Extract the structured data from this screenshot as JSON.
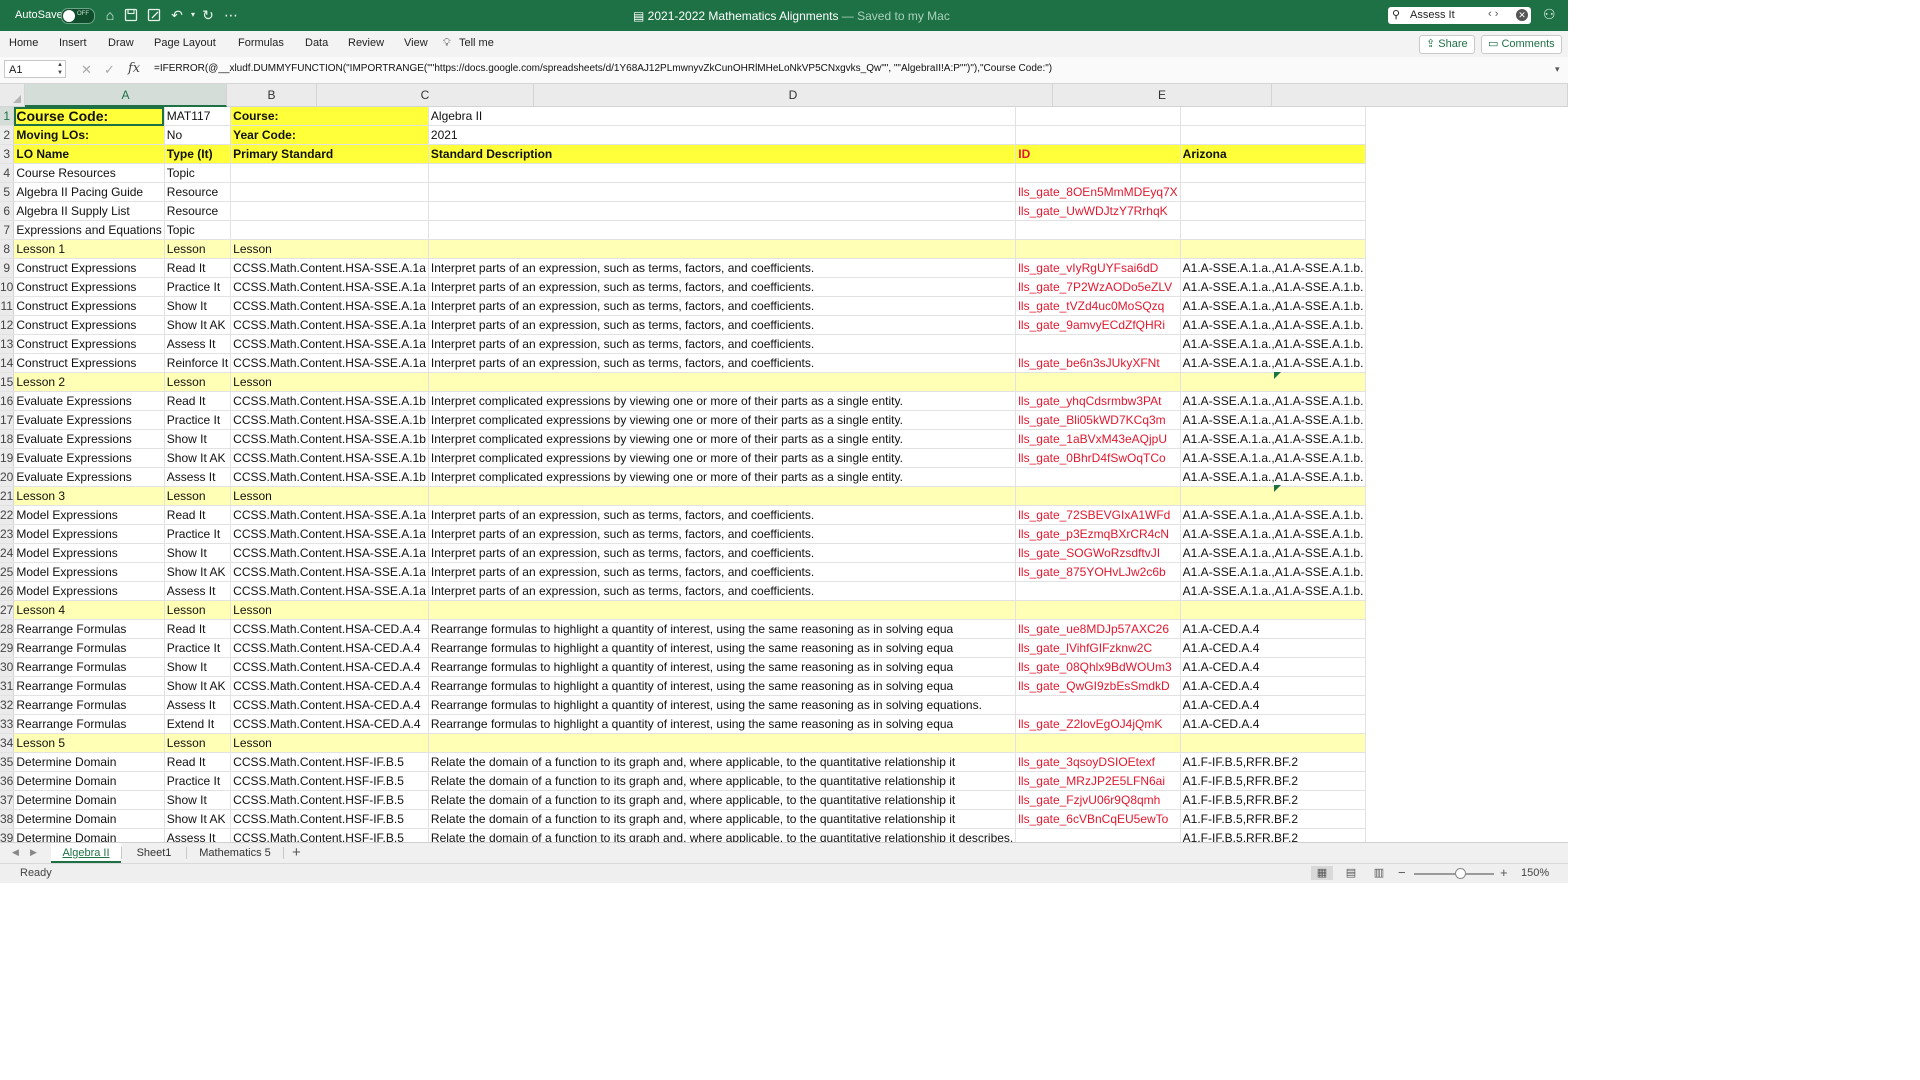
{
  "titlebar": {
    "autosave_label": "AutoSave",
    "autosave_state": "OFF",
    "doc_title": "2021-2022 Mathematics Alignments",
    "saved_status": "— Saved to my Mac",
    "search_value": "Assess It"
  },
  "ribbon": {
    "tabs": [
      "Home",
      "Insert",
      "Draw",
      "Page Layout",
      "Formulas",
      "Data",
      "Review",
      "View"
    ],
    "tell_me": "Tell me",
    "share": "Share",
    "comments": "Comments"
  },
  "formula_bar": {
    "name_box": "A1",
    "formula": "=IFERROR(@__xludf.DUMMYFUNCTION(\"IMPORTRANGE(\"\"https://docs.google.com/spreadsheets/d/1Y68AJ12PLmwnyvZkCunOHRlMHeLoNkVP5CNxgvks_Qw\"\", \"\"AlgebraII!A:P\"\")\"),\"Course Code:\")"
  },
  "columns": [
    "A",
    "B",
    "C",
    "D",
    "E",
    ""
  ],
  "rows": [
    {
      "n": "1",
      "c": [
        "Course Code:",
        "MAT117",
        "Course:",
        "Algebra II",
        "",
        ""
      ]
    },
    {
      "n": "2",
      "c": [
        "Moving LOs:",
        "No",
        "Year Code:",
        "2021",
        "",
        ""
      ]
    },
    {
      "n": "3",
      "c": [
        "LO Name",
        "Type (It)",
        "Primary Standard",
        "Standard Description",
        "ID",
        "Arizona"
      ]
    },
    {
      "n": "4",
      "c": [
        "Course Resources",
        "Topic",
        "",
        "",
        "",
        ""
      ]
    },
    {
      "n": "5",
      "c": [
        "Algebra II Pacing Guide",
        "Resource",
        "",
        "",
        "lls_gate_8OEn5MmMDEyq7X",
        ""
      ]
    },
    {
      "n": "6",
      "c": [
        "Algebra II Supply List",
        "Resource",
        "",
        "",
        "lls_gate_UwWDJtzY7RrhqK",
        ""
      ]
    },
    {
      "n": "7",
      "c": [
        "Expressions and Equations",
        "Topic",
        "",
        "",
        "",
        ""
      ]
    },
    {
      "n": "8",
      "c": [
        "Lesson 1",
        "Lesson",
        "Lesson",
        "",
        "",
        ""
      ]
    },
    {
      "n": "9",
      "c": [
        "Construct Expressions",
        "Read It",
        "CCSS.Math.Content.HSA-SSE.A.1a",
        "Interpret parts of an expression, such as terms, factors, and coefficients.",
        "lls_gate_vIyRgUYFsai6dD",
        "A1.A-SSE.A.1.a.,A1.A-SSE.A.1.b."
      ]
    },
    {
      "n": "10",
      "c": [
        "Construct Expressions",
        "Practice It",
        "CCSS.Math.Content.HSA-SSE.A.1a",
        "Interpret parts of an expression, such as terms, factors, and coefficients.",
        "lls_gate_7P2WzAODo5eZLV",
        "A1.A-SSE.A.1.a.,A1.A-SSE.A.1.b."
      ]
    },
    {
      "n": "11",
      "c": [
        "Construct Expressions",
        "Show It",
        "CCSS.Math.Content.HSA-SSE.A.1a",
        "Interpret parts of an expression, such as terms, factors, and coefficients.",
        "lls_gate_tVZd4uc0MoSQzq",
        "A1.A-SSE.A.1.a.,A1.A-SSE.A.1.b."
      ]
    },
    {
      "n": "12",
      "c": [
        "Construct Expressions",
        "Show It AK",
        "CCSS.Math.Content.HSA-SSE.A.1a",
        "Interpret parts of an expression, such as terms, factors, and coefficients.",
        "lls_gate_9amvyECdZfQHRi",
        "A1.A-SSE.A.1.a.,A1.A-SSE.A.1.b."
      ]
    },
    {
      "n": "13",
      "c": [
        "Construct Expressions",
        "Assess It",
        "CCSS.Math.Content.HSA-SSE.A.1a",
        "Interpret parts of an expression, such as terms, factors, and coefficients.",
        "",
        "A1.A-SSE.A.1.a.,A1.A-SSE.A.1.b."
      ]
    },
    {
      "n": "14",
      "c": [
        "Construct Expressions",
        "Reinforce It",
        "CCSS.Math.Content.HSA-SSE.A.1a",
        "Interpret parts of an expression, such as terms, factors, and coefficients.",
        "lls_gate_be6n3sJUkyXFNt",
        "A1.A-SSE.A.1.a.,A1.A-SSE.A.1.b."
      ]
    },
    {
      "n": "15",
      "c": [
        "Lesson 2",
        "Lesson",
        "Lesson",
        "",
        "",
        ""
      ]
    },
    {
      "n": "16",
      "c": [
        "Evaluate Expressions",
        "Read It",
        "CCSS.Math.Content.HSA-SSE.A.1b",
        "Interpret complicated expressions by viewing one or more of their parts as a single entity.",
        "lls_gate_yhqCdsrmbw3PAt",
        "A1.A-SSE.A.1.a.,A1.A-SSE.A.1.b."
      ]
    },
    {
      "n": "17",
      "c": [
        "Evaluate Expressions",
        "Practice It",
        "CCSS.Math.Content.HSA-SSE.A.1b",
        "Interpret complicated expressions by viewing one or more of their parts as a single entity.",
        "lls_gate_Bli05kWD7KCq3m",
        "A1.A-SSE.A.1.a.,A1.A-SSE.A.1.b."
      ]
    },
    {
      "n": "18",
      "c": [
        "Evaluate Expressions",
        "Show It",
        "CCSS.Math.Content.HSA-SSE.A.1b",
        "Interpret complicated expressions by viewing one or more of their parts as a single entity.",
        "lls_gate_1aBVxM43eAQjpU",
        "A1.A-SSE.A.1.a.,A1.A-SSE.A.1.b."
      ]
    },
    {
      "n": "19",
      "c": [
        "Evaluate Expressions",
        "Show It AK",
        "CCSS.Math.Content.HSA-SSE.A.1b",
        "Interpret complicated expressions by viewing one or more of their parts as a single entity.",
        "lls_gate_0BhrD4fSwOqTCo",
        "A1.A-SSE.A.1.a.,A1.A-SSE.A.1.b."
      ]
    },
    {
      "n": "20",
      "c": [
        "Evaluate Expressions",
        "Assess It",
        "CCSS.Math.Content.HSA-SSE.A.1b",
        "Interpret complicated expressions by viewing one or more of their parts as a single entity.",
        "",
        "A1.A-SSE.A.1.a.,A1.A-SSE.A.1.b."
      ]
    },
    {
      "n": "21",
      "c": [
        "Lesson 3",
        "Lesson",
        "Lesson",
        "",
        "",
        ""
      ]
    },
    {
      "n": "22",
      "c": [
        "Model Expressions",
        "Read It",
        "CCSS.Math.Content.HSA-SSE.A.1a",
        "Interpret parts of an expression, such as terms, factors, and coefficients.",
        "lls_gate_72SBEVGIxA1WFd",
        "A1.A-SSE.A.1.a.,A1.A-SSE.A.1.b."
      ]
    },
    {
      "n": "23",
      "c": [
        "Model Expressions",
        "Practice It",
        "CCSS.Math.Content.HSA-SSE.A.1a",
        "Interpret parts of an expression, such as terms, factors, and coefficients.",
        "lls_gate_p3EzmqBXrCR4cN",
        "A1.A-SSE.A.1.a.,A1.A-SSE.A.1.b."
      ]
    },
    {
      "n": "24",
      "c": [
        "Model Expressions",
        "Show It",
        "CCSS.Math.Content.HSA-SSE.A.1a",
        "Interpret parts of an expression, such as terms, factors, and coefficients.",
        "lls_gate_SOGWoRzsdftvJI",
        "A1.A-SSE.A.1.a.,A1.A-SSE.A.1.b."
      ]
    },
    {
      "n": "25",
      "c": [
        "Model Expressions",
        "Show It AK",
        "CCSS.Math.Content.HSA-SSE.A.1a",
        "Interpret parts of an expression, such as terms, factors, and coefficients.",
        "lls_gate_875YOHvLJw2c6b",
        "A1.A-SSE.A.1.a.,A1.A-SSE.A.1.b."
      ]
    },
    {
      "n": "26",
      "c": [
        "Model Expressions",
        "Assess It",
        "CCSS.Math.Content.HSA-SSE.A.1a",
        "Interpret parts of an expression, such as terms, factors, and coefficients.",
        "",
        "A1.A-SSE.A.1.a.,A1.A-SSE.A.1.b."
      ]
    },
    {
      "n": "27",
      "c": [
        "Lesson 4",
        "Lesson",
        "Lesson",
        "",
        "",
        ""
      ]
    },
    {
      "n": "28",
      "c": [
        "Rearrange Formulas",
        "Read It",
        "CCSS.Math.Content.HSA-CED.A.4",
        "Rearrange formulas to highlight a quantity of interest, using the same reasoning as in solving equa",
        "lls_gate_ue8MDJp57AXC26",
        "A1.A-CED.A.4"
      ]
    },
    {
      "n": "29",
      "c": [
        "Rearrange Formulas",
        "Practice It",
        "CCSS.Math.Content.HSA-CED.A.4",
        "Rearrange formulas to highlight a quantity of interest, using the same reasoning as in solving equa",
        "lls_gate_lVihfGIFzknw2C",
        "A1.A-CED.A.4"
      ]
    },
    {
      "n": "30",
      "c": [
        "Rearrange Formulas",
        "Show It",
        "CCSS.Math.Content.HSA-CED.A.4",
        "Rearrange formulas to highlight a quantity of interest, using the same reasoning as in solving equa",
        "lls_gate_08Qhlx9BdWOUm3",
        "A1.A-CED.A.4"
      ]
    },
    {
      "n": "31",
      "c": [
        "Rearrange Formulas",
        "Show It AK",
        "CCSS.Math.Content.HSA-CED.A.4",
        "Rearrange formulas to highlight a quantity of interest, using the same reasoning as in solving equa",
        "lls_gate_QwGI9zbEsSmdkD",
        "A1.A-CED.A.4"
      ]
    },
    {
      "n": "32",
      "c": [
        "Rearrange Formulas",
        "Assess It",
        "CCSS.Math.Content.HSA-CED.A.4",
        "Rearrange formulas to highlight a quantity of interest, using the same reasoning as in solving equations.",
        "",
        "A1.A-CED.A.4"
      ]
    },
    {
      "n": "33",
      "c": [
        "Rearrange Formulas",
        "Extend It",
        "CCSS.Math.Content.HSA-CED.A.4",
        "Rearrange formulas to highlight a quantity of interest, using the same reasoning as in solving equa",
        "lls_gate_Z2lovEgOJ4jQmK",
        "A1.A-CED.A.4"
      ]
    },
    {
      "n": "34",
      "c": [
        "Lesson 5",
        "Lesson",
        "Lesson",
        "",
        "",
        ""
      ]
    },
    {
      "n": "35",
      "c": [
        "Determine Domain",
        "Read It",
        "CCSS.Math.Content.HSF-IF.B.5",
        "Relate the domain of a function to its graph and, where applicable, to the quantitative relationship it",
        "lls_gate_3qsoyDSIOEtexf",
        "A1.F-IF.B.5,RFR.BF.2"
      ]
    },
    {
      "n": "36",
      "c": [
        "Determine Domain",
        "Practice It",
        "CCSS.Math.Content.HSF-IF.B.5",
        "Relate the domain of a function to its graph and, where applicable, to the quantitative relationship it",
        "lls_gate_MRzJP2E5LFN6ai",
        "A1.F-IF.B.5,RFR.BF.2"
      ]
    },
    {
      "n": "37",
      "c": [
        "Determine Domain",
        "Show It",
        "CCSS.Math.Content.HSF-IF.B.5",
        "Relate the domain of a function to its graph and, where applicable, to the quantitative relationship it",
        "lls_gate_FzjvU06r9Q8qmh",
        "A1.F-IF.B.5,RFR.BF.2"
      ]
    },
    {
      "n": "38",
      "c": [
        "Determine Domain",
        "Show It AK",
        "CCSS.Math.Content.HSF-IF.B.5",
        "Relate the domain of a function to its graph and, where applicable, to the quantitative relationship it",
        "lls_gate_6cVBnCqEU5ewTo",
        "A1.F-IF.B.5,RFR.BF.2"
      ]
    },
    {
      "n": "39",
      "c": [
        "Determine Domain",
        "Assess It",
        "CCSS.Math.Content.HSF-IF.B.5",
        "Relate the domain of a function to its graph and, where applicable, to the quantitative relationship it describes.",
        "",
        "A1.F-IF.B.5,RFR.BF.2"
      ]
    }
  ],
  "sheet_tabs": [
    "Algebra II",
    "Sheet1",
    "Mathematics 5"
  ],
  "status": {
    "ready": "Ready",
    "zoom": "150%"
  },
  "colors": {
    "accent": "#1e7145",
    "header_yellow": "#ffff3a",
    "lesson_yellow": "#ffffb5",
    "id_red": "#e0182f"
  }
}
